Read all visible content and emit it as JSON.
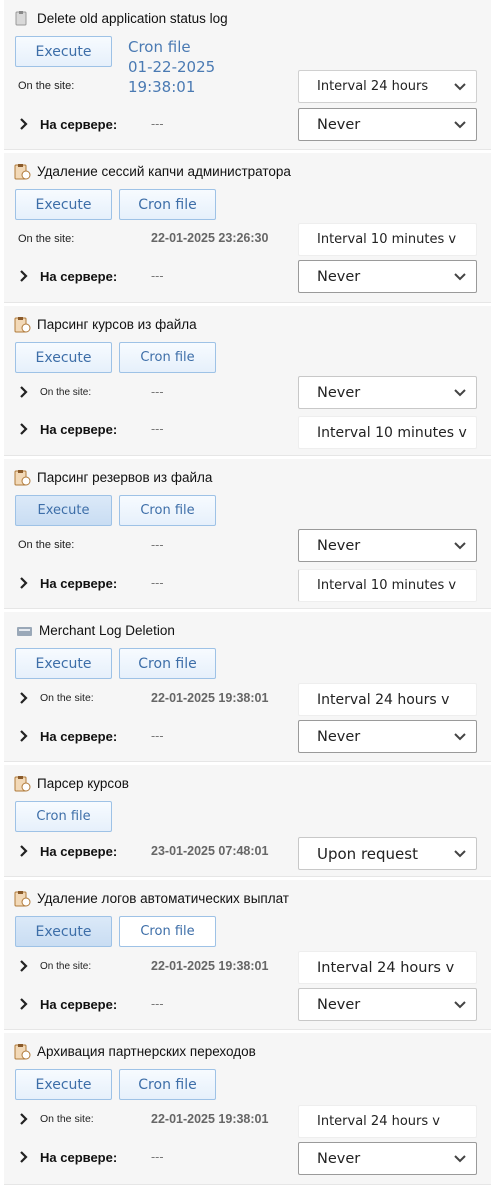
{
  "tasks": [
    {
      "title": "Delete old application status log",
      "execute_label": "Execute",
      "cron_label": "Cron file\n01-22-2025\n19:38:01",
      "site_label": "On the site:",
      "site_value": "",
      "site_select": "Interval 24 hours",
      "server_label": "На сервере:",
      "server_value": "---",
      "server_select": "Never"
    },
    {
      "title": "Удаление сессий капчи администратора",
      "execute_label": "Execute",
      "cron_label": "Cron file",
      "site_label": "On the site:",
      "site_value": "22-01-2025 23:26:30",
      "site_select": "Interval 10 minutes v",
      "server_label": "На сервере:",
      "server_value": "---",
      "server_select": "Never"
    },
    {
      "title": "Парсинг курсов из файла",
      "execute_label": "Execute",
      "cron_label": "Cron file",
      "site_label": "On the site:",
      "site_value": "---",
      "site_select": "Never",
      "server_label": "На сервере:",
      "server_value": "---",
      "server_select": "Interval 10 minutes v"
    },
    {
      "title": "Парсинг резервов из файла",
      "execute_label": "Execute",
      "cron_label": "Cron file",
      "site_label": "On the site:",
      "site_value": "---",
      "site_select": "Never",
      "server_label": "На сервере:",
      "server_value": "---",
      "server_select": "Interval 10 minutes v"
    },
    {
      "title": "Merchant Log Deletion",
      "execute_label": "Execute",
      "cron_label": "Cron file",
      "site_label": "On the site:",
      "site_value": "22-01-2025 19:38:01",
      "site_select": "Interval 24 hours v",
      "server_label": "На сервере:",
      "server_value": "---",
      "server_select": "Never"
    },
    {
      "title": "Парсер курсов",
      "cron_label": "Cron file",
      "server_label": "На сервере:",
      "server_value": "23-01-2025 07:48:01",
      "server_select": "Upon request"
    },
    {
      "title": "Удаление логов автоматических выплат",
      "execute_label": "Execute",
      "cron_label": "Cron file",
      "site_label": "On the site:",
      "site_value": "22-01-2025 19:38:01",
      "site_select": "Interval 24 hours v",
      "server_label": "На сервере:",
      "server_value": "---",
      "server_select": "Never"
    },
    {
      "title": "Архивация партнерских переходов",
      "execute_label": "Execute",
      "cron_label": "Cron file",
      "site_label": "On the site:",
      "site_value": "22-01-2025 19:38:01",
      "site_select": "Interval 24 hours v",
      "server_label": "На сервере:",
      "server_value": "---",
      "server_select": "Never"
    }
  ],
  "colors": {
    "button_text": "#3d6ea8",
    "button_border": "#9ec2e6",
    "card_bg": "#f6f6f6"
  },
  "icons": {
    "task": "clipboard-clock-icon",
    "expand": "chevron-right-icon",
    "dropdown": "chevron-down-icon"
  }
}
